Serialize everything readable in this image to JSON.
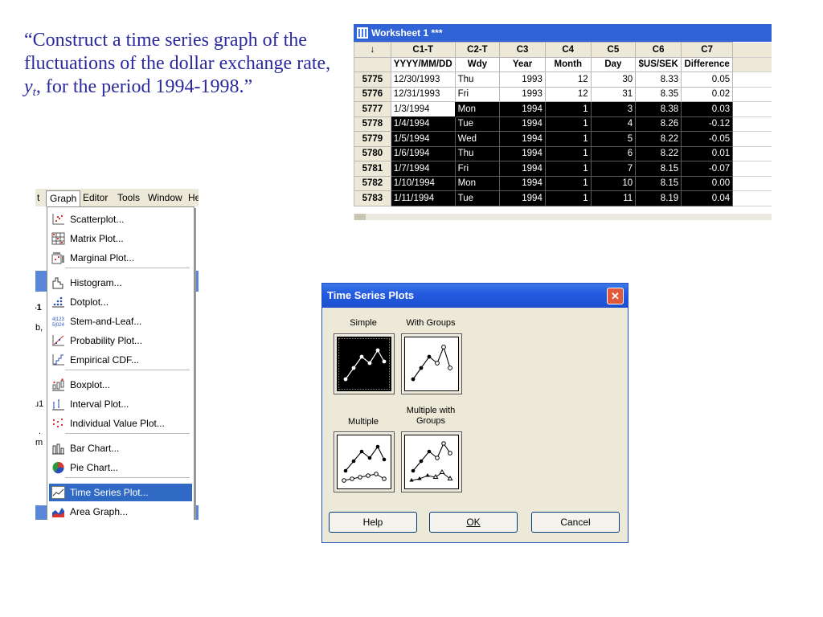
{
  "quote": {
    "part1": "“Construct a time series graph of the fluctuations of the dollar exchange rate, ",
    "var": "y",
    "sub": "t",
    "part2": ", for the period 1994-1998.”"
  },
  "worksheet": {
    "title": "Worksheet 1 ***",
    "corner": "↓",
    "columns": [
      {
        "id": "C1-T",
        "name": "YYYY/MM/DD"
      },
      {
        "id": "C2-T",
        "name": "Wdy"
      },
      {
        "id": "C3",
        "name": "Year"
      },
      {
        "id": "C4",
        "name": "Month"
      },
      {
        "id": "C5",
        "name": "Day"
      },
      {
        "id": "C6",
        "name": "$US/SEK"
      },
      {
        "id": "C7",
        "name": "Difference"
      }
    ],
    "rows": [
      {
        "n": "5775",
        "cells": [
          "12/30/1993",
          "Thu",
          "1993",
          "12",
          "30",
          "8.33",
          "0.05"
        ],
        "selected": false
      },
      {
        "n": "5776",
        "cells": [
          "12/31/1993",
          "Fri",
          "1993",
          "12",
          "31",
          "8.35",
          "0.02"
        ],
        "selected": false
      },
      {
        "n": "5777",
        "cells": [
          "1/3/1994",
          "Mon",
          "1994",
          "1",
          "3",
          "8.38",
          "0.03"
        ],
        "selected": true
      },
      {
        "n": "5778",
        "cells": [
          "1/4/1994",
          "Tue",
          "1994",
          "1",
          "4",
          "8.26",
          "-0.12"
        ],
        "selected": true
      },
      {
        "n": "5779",
        "cells": [
          "1/5/1994",
          "Wed",
          "1994",
          "1",
          "5",
          "8.22",
          "-0.05"
        ],
        "selected": true
      },
      {
        "n": "5780",
        "cells": [
          "1/6/1994",
          "Thu",
          "1994",
          "1",
          "6",
          "8.22",
          "0.01"
        ],
        "selected": true
      },
      {
        "n": "5781",
        "cells": [
          "1/7/1994",
          "Fri",
          "1994",
          "1",
          "7",
          "8.15",
          "-0.07"
        ],
        "selected": true
      },
      {
        "n": "5782",
        "cells": [
          "1/10/1994",
          "Mon",
          "1994",
          "1",
          "10",
          "8.15",
          "0.00"
        ],
        "selected": true
      },
      {
        "n": "5783",
        "cells": [
          "1/11/1994",
          "Tue",
          "1994",
          "1",
          "11",
          "8.19",
          "0.04"
        ],
        "selected": true
      }
    ]
  },
  "menubar": {
    "items": [
      "t",
      "Graph",
      "Editor",
      "Tools",
      "Window",
      "He"
    ],
    "strip": [
      "-1",
      "b,",
      "u1",
      ".",
      "m"
    ]
  },
  "graph_menu": {
    "items": [
      {
        "label": "Scatterplot...",
        "icon": "scatterplot-icon"
      },
      {
        "label": "Matrix Plot...",
        "icon": "matrix-plot-icon"
      },
      {
        "label": "Marginal Plot...",
        "icon": "marginal-plot-icon"
      },
      {
        "label": "Histogram...",
        "icon": "histogram-icon"
      },
      {
        "label": "Dotplot...",
        "icon": "dotplot-icon"
      },
      {
        "label": "Stem-and-Leaf...",
        "icon": "stem-leaf-icon"
      },
      {
        "label": "Probability Plot...",
        "icon": "probability-plot-icon"
      },
      {
        "label": "Empirical CDF...",
        "icon": "empirical-cdf-icon"
      },
      {
        "label": "Boxplot...",
        "icon": "boxplot-icon"
      },
      {
        "label": "Interval Plot...",
        "icon": "interval-plot-icon"
      },
      {
        "label": "Individual Value Plot...",
        "icon": "individual-value-plot-icon"
      },
      {
        "label": "Bar Chart...",
        "icon": "bar-chart-icon"
      },
      {
        "label": "Pie Chart...",
        "icon": "pie-chart-icon"
      },
      {
        "label": "Time Series Plot...",
        "icon": "time-series-icon",
        "highlighted": true
      },
      {
        "label": "Area Graph...",
        "icon": "area-graph-icon"
      }
    ]
  },
  "dialog": {
    "title": "Time Series Plots",
    "close": "✕",
    "options": [
      {
        "label": "Simple",
        "selected": true
      },
      {
        "label": "With Groups",
        "selected": false
      },
      {
        "label": "Multiple",
        "selected": false
      },
      {
        "label": "Multiple with Groups",
        "selected": false
      }
    ],
    "buttons": {
      "help": "Help",
      "ok": "OK",
      "cancel": "Cancel"
    }
  },
  "colors": {
    "quote_text": "#2a2a9e",
    "title_bar": "#2f63d6",
    "menu_highlight": "#316ac5",
    "selection": "#000000"
  }
}
